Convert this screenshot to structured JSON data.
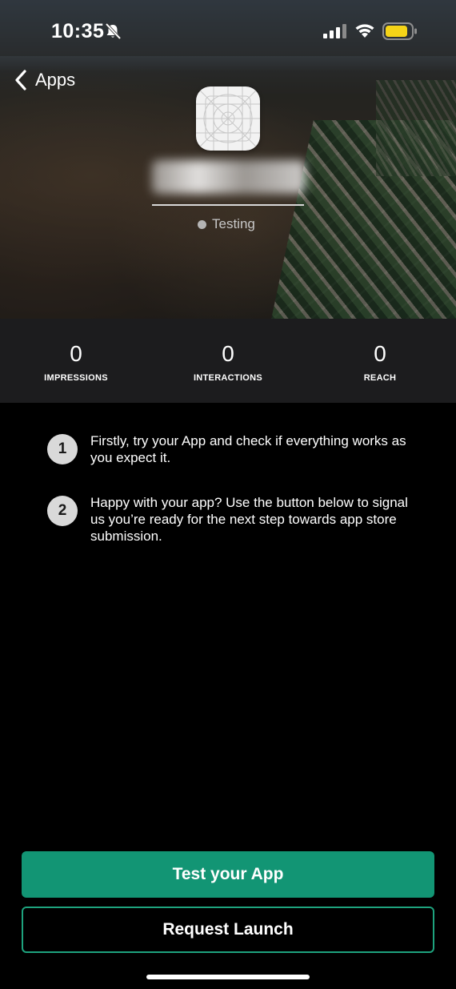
{
  "status_bar": {
    "time": "10:35",
    "battery_color": "#f5d418"
  },
  "nav": {
    "back_label": "Apps"
  },
  "app": {
    "status_label": "Testing"
  },
  "stats": [
    {
      "value": "0",
      "label": "IMPRESSIONS"
    },
    {
      "value": "0",
      "label": "INTERACTIONS"
    },
    {
      "value": "0",
      "label": "REACH"
    }
  ],
  "steps": [
    {
      "number": "1",
      "text": "Firstly, try your App and check if everything works as you expect it."
    },
    {
      "number": "2",
      "text": "Happy with your app? Use the button below to signal us you’re ready for the next step towards app store submission."
    }
  ],
  "buttons": {
    "test_label": "Test your App",
    "launch_label": "Request Launch"
  },
  "colors": {
    "primary": "#129574",
    "outline": "#1ea37e",
    "stats_bg": "#1c1c1e"
  }
}
